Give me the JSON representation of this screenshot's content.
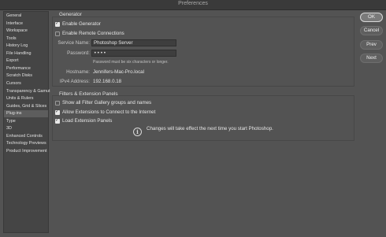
{
  "window": {
    "title": "Preferences"
  },
  "sidebar": {
    "items": [
      {
        "label": "General"
      },
      {
        "label": "Interface"
      },
      {
        "label": "Workspace"
      },
      {
        "label": "Tools"
      },
      {
        "label": "History Log"
      },
      {
        "label": "File Handling"
      },
      {
        "label": "Export"
      },
      {
        "label": "Performance"
      },
      {
        "label": "Scratch Disks"
      },
      {
        "label": "Cursors"
      },
      {
        "label": "Transparency & Gamut"
      },
      {
        "label": "Units & Rulers"
      },
      {
        "label": "Guides, Grid & Slices"
      },
      {
        "label": "Plug-ins"
      },
      {
        "label": "Type"
      },
      {
        "label": "3D"
      },
      {
        "label": "Enhanced Controls"
      },
      {
        "label": "Technology Previews"
      },
      {
        "label": "Product Improvement"
      }
    ],
    "active": "Plug-ins"
  },
  "generator": {
    "title": "Generator",
    "enable_generator": {
      "label": "Enable Generator",
      "checked": true
    },
    "enable_remote": {
      "label": "Enable Remote Connections",
      "checked": false
    },
    "service_name_label": "Service Name:",
    "service_name_value": "Photoshop Server",
    "password_label": "Password:",
    "password_value": "••••",
    "password_hint": "Password must be six characters or longer.",
    "hostname_label": "Hostname:",
    "hostname_value": "Jennifers-Mac-Pro.local",
    "ipv4_label": "IPv4 Address:",
    "ipv4_value": "192.168.0.18"
  },
  "filter_panels": {
    "title": "Filters & Extension Panels",
    "show_all_filter": {
      "label": "Show all Filter Gallery groups and names",
      "checked": false
    },
    "allow_extensions": {
      "label": "Allow Extensions to Connect to the Internet",
      "checked": true
    },
    "load_extension": {
      "label": "Load Extension Panels",
      "checked": true
    },
    "note": "Changes will take effect the next time you start Photoshop."
  },
  "buttons": {
    "ok": "OK",
    "cancel": "Cancel",
    "prev": "Prev",
    "next": "Next"
  },
  "colors": {
    "background": "#535353",
    "sidebar": "#454545",
    "selected_item": "#5d5d5d"
  }
}
